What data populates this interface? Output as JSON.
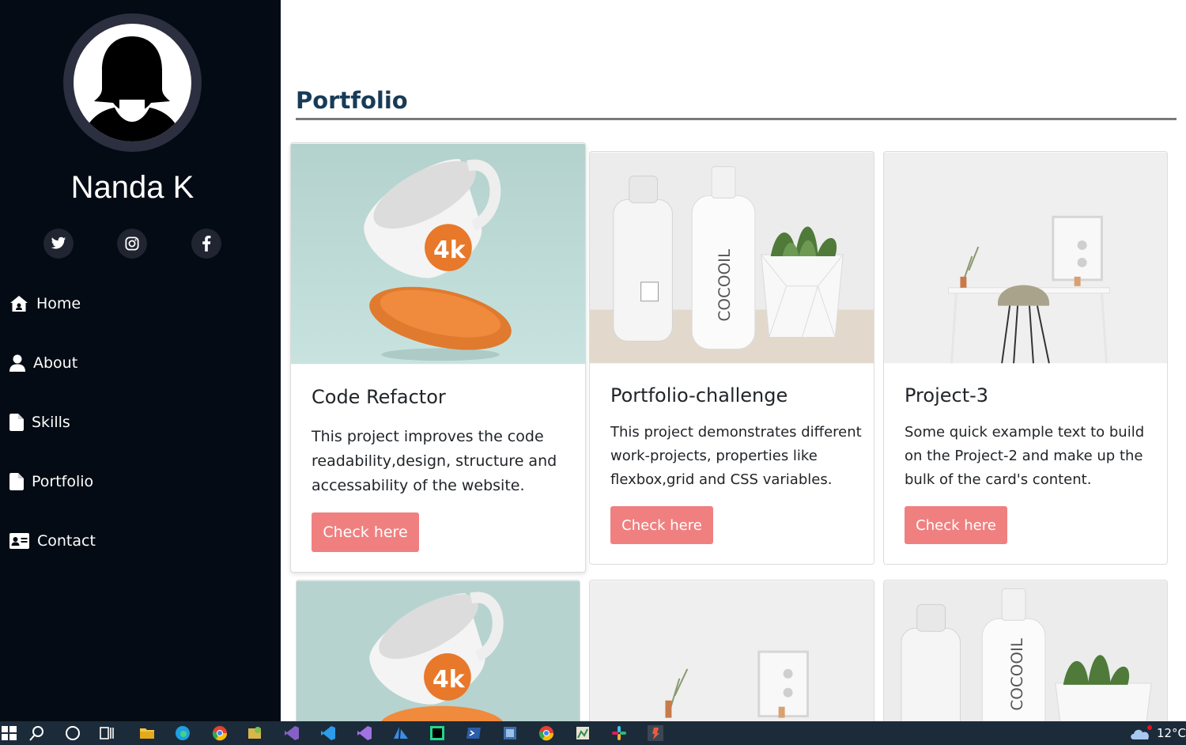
{
  "sidebar": {
    "name": "Nanda K",
    "socials": [
      {
        "icon": "twitter-icon"
      },
      {
        "icon": "instagram-icon"
      },
      {
        "icon": "facebook-icon"
      }
    ],
    "nav": [
      {
        "label": "Home",
        "icon": "home-icon"
      },
      {
        "label": "About",
        "icon": "user-icon"
      },
      {
        "label": "Skills",
        "icon": "file-icon"
      },
      {
        "label": "Portfolio",
        "icon": "file-icon"
      },
      {
        "label": "Contact",
        "icon": "address-card-icon"
      }
    ]
  },
  "portfolio": {
    "title": "Portfolio",
    "cards": [
      {
        "title": "Code Refactor",
        "text": "This project improves the code readability,design, structure and accessability of the website.",
        "button": "Check here",
        "image": "mug-image"
      },
      {
        "title": "Portfolio-challenge",
        "text": "This project demonstrates different work-projects, properties like flexbox,grid and CSS variables.",
        "button": "Check here",
        "image": "bottle-image"
      },
      {
        "title": "Project-3",
        "text": "Some quick example text to build on the Project-2 and make up the bulk of the card's content.",
        "button": "Check here",
        "image": "desk-image"
      }
    ],
    "bottle_label": "COCOOIL"
  },
  "taskbar": {
    "temperature": "12°C"
  },
  "colors": {
    "sidebar_bg": "#040b14",
    "button_bg": "#f08080",
    "title": "#173b57"
  }
}
